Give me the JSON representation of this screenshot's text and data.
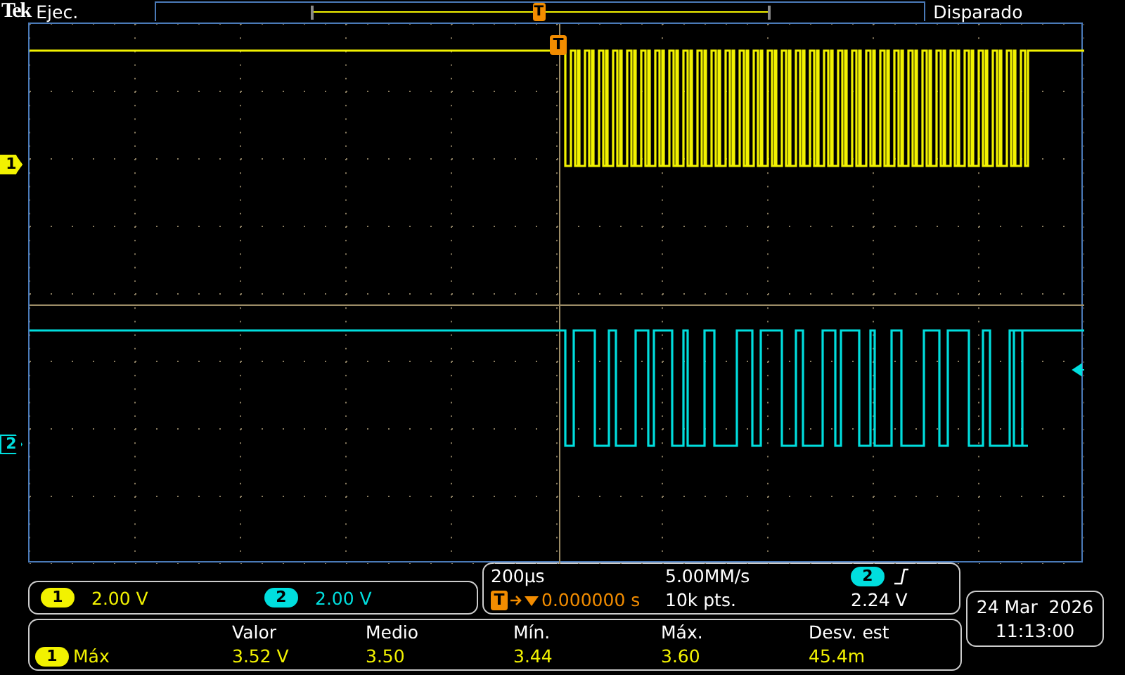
{
  "status": {
    "logo": "Tek",
    "run_state": "Ejec.",
    "trigger_state": "Disparado",
    "trigger_marker": "T",
    "graticule_trigger_marker": "T"
  },
  "channels": [
    {
      "label": "1",
      "badge": "1",
      "color": "#f2f200",
      "scale": "2.00 V"
    },
    {
      "label": "2",
      "badge": "2",
      "color": "#00dede",
      "scale": "2.00 V"
    }
  ],
  "timebase": {
    "horizontal_scale": "200µs",
    "sample_rate": "5.00MM/s",
    "trigger_position_marker": "T",
    "trigger_delay": "0.000000 s",
    "record_length": "10k pts.",
    "trigger_source": "2",
    "trigger_level": "2.24 V"
  },
  "datetime": {
    "date": "24 Mar  2026",
    "time": "11:13:00"
  },
  "measurements": {
    "columns": [
      "Valor",
      "Medio",
      "Mín.",
      "Máx.",
      "Desv. est"
    ],
    "rows": [
      {
        "channel": "1",
        "type": "Máx",
        "values": [
          "3.52 V",
          "3.50",
          "3.44",
          "3.60",
          "45.4m"
        ]
      }
    ]
  }
}
